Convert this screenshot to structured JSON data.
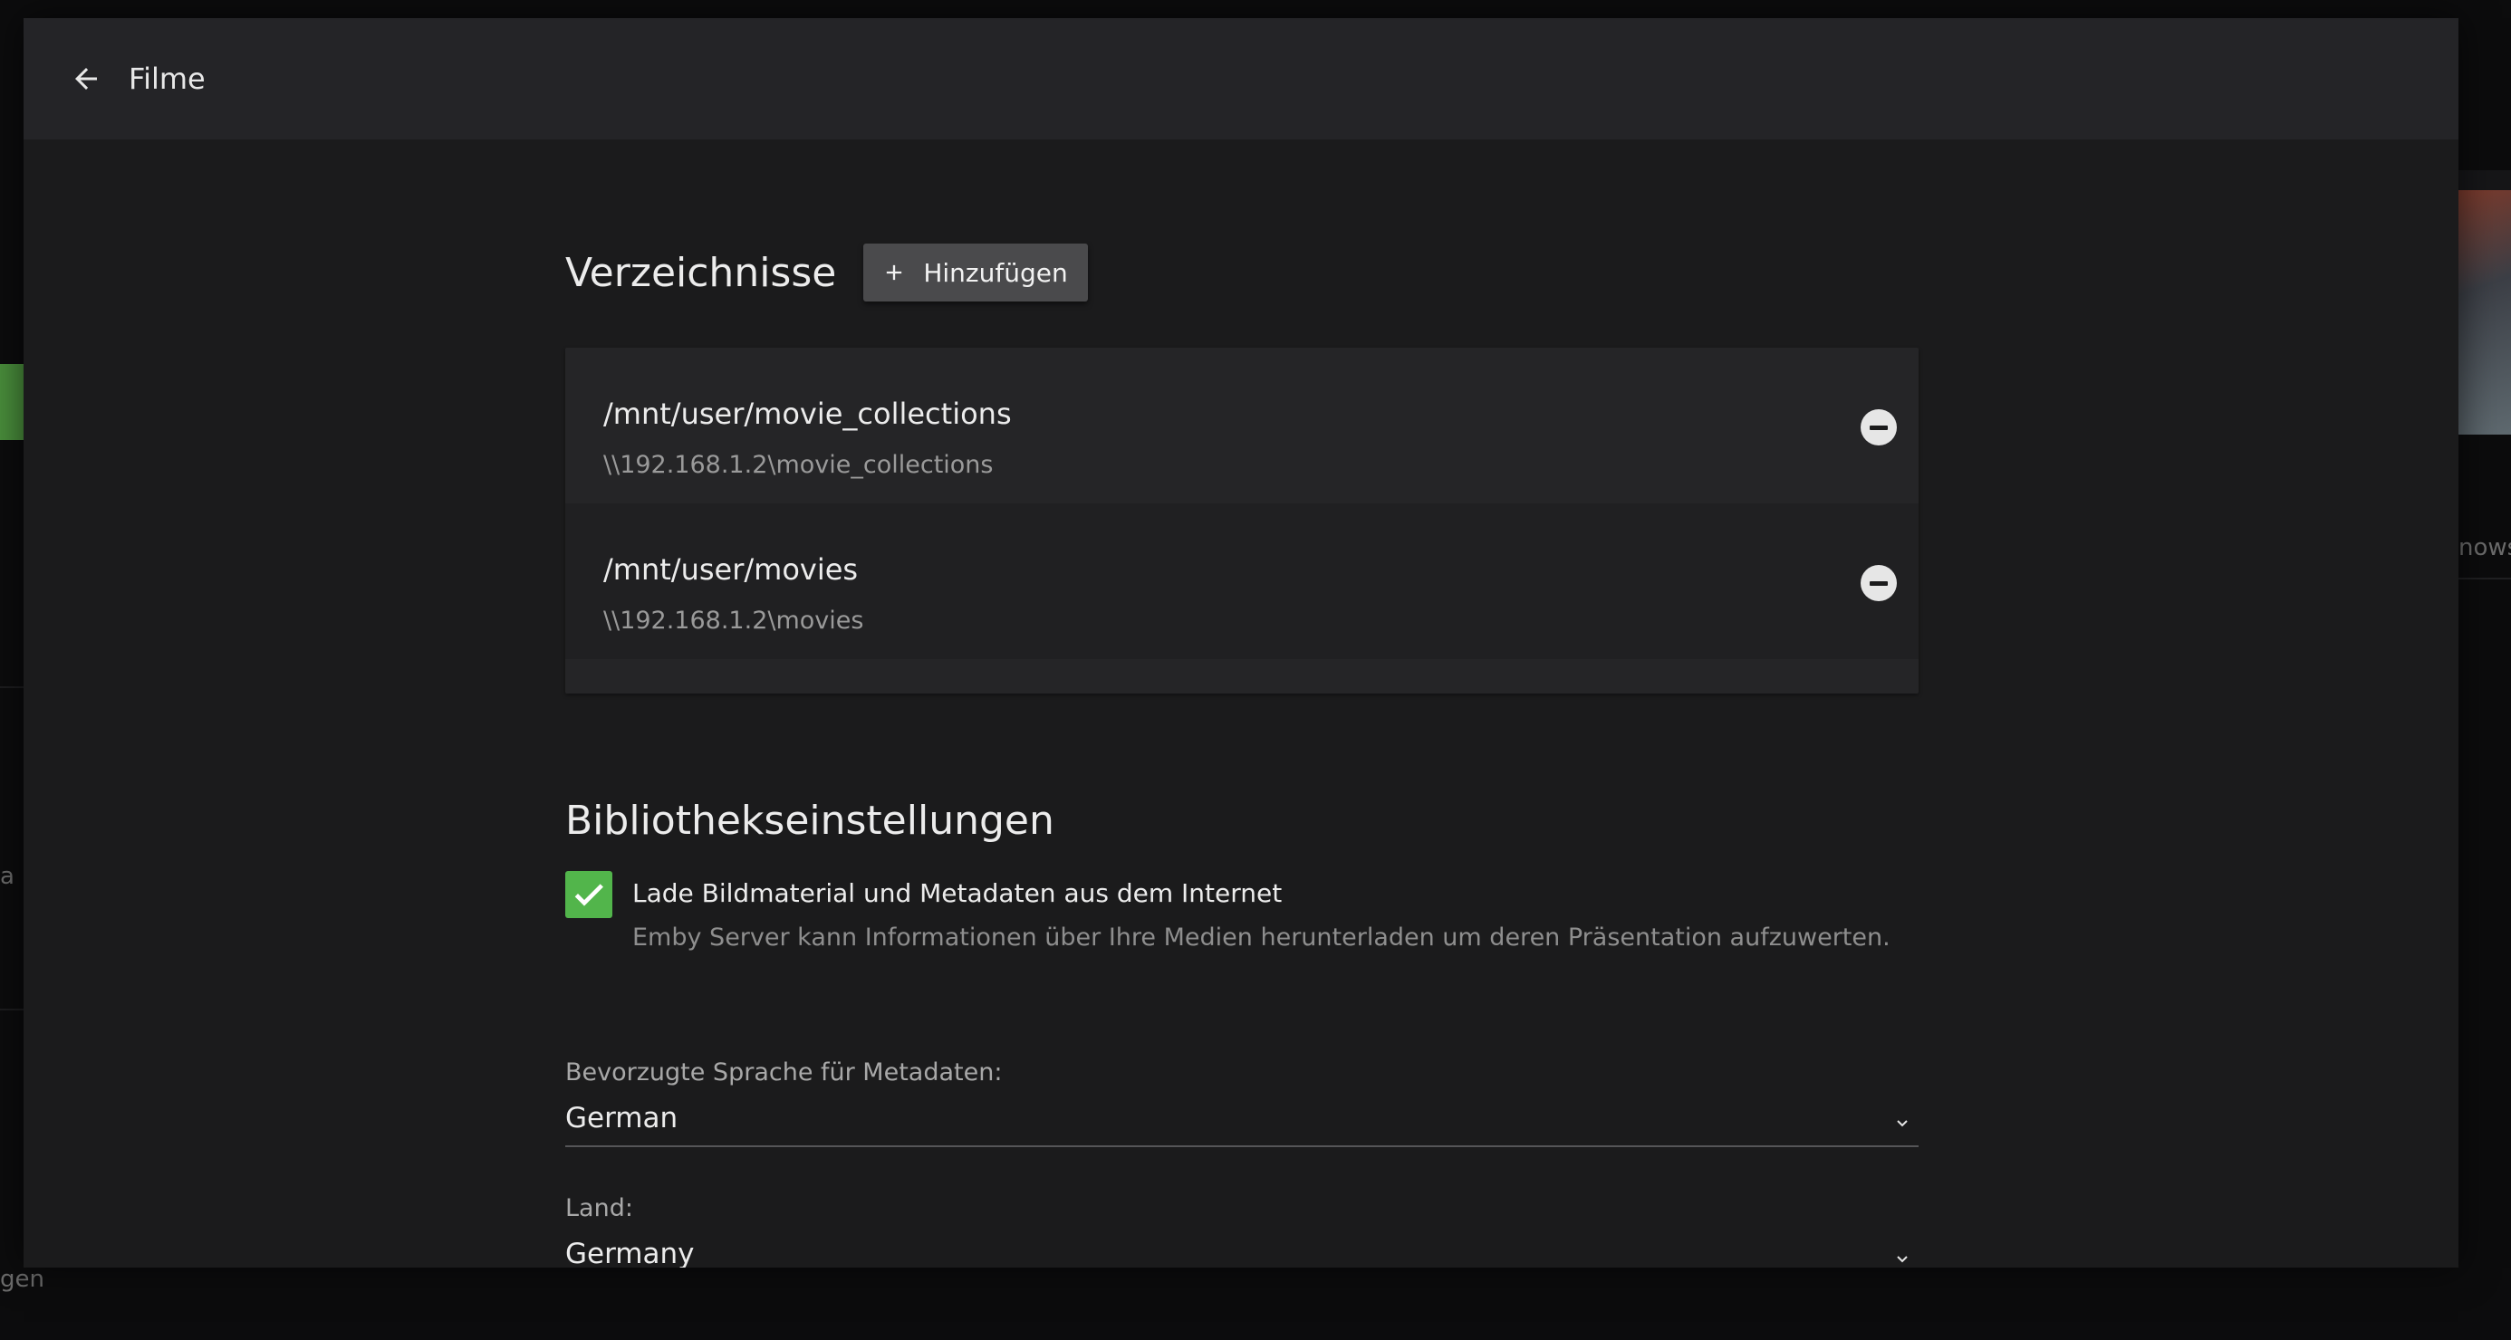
{
  "background": {
    "left_fragment_1": "a S",
    "left_fragment_2": "gen",
    "right_fragment": "nows"
  },
  "dialog": {
    "title": "Filme",
    "back_icon": "arrow-left-icon"
  },
  "folders": {
    "section_title": "Verzeichnisse",
    "add_label": "Hinzufügen",
    "items": [
      {
        "path": "/mnt/user/movie_collections",
        "network_path": "\\\\192.168.1.2\\movie_collections"
      },
      {
        "path": "/mnt/user/movies",
        "network_path": "\\\\192.168.1.2\\movies"
      }
    ]
  },
  "library": {
    "section_title": "Bibliothekseinstellungen",
    "download_metadata": {
      "label": "Lade Bildmaterial und Metadaten aus dem Internet",
      "description": "Emby Server kann Informationen über Ihre Medien herunterladen um deren Präsentation aufzuwerten.",
      "checked": true
    },
    "metadata_language": {
      "label": "Bevorzugte Sprache für Metadaten:",
      "value": "German"
    },
    "country": {
      "label": "Land:",
      "value": "Germany"
    }
  },
  "colors": {
    "accent_green": "#52b54b",
    "dialog_bg": "#1b1b1c",
    "header_bg": "#242427"
  }
}
